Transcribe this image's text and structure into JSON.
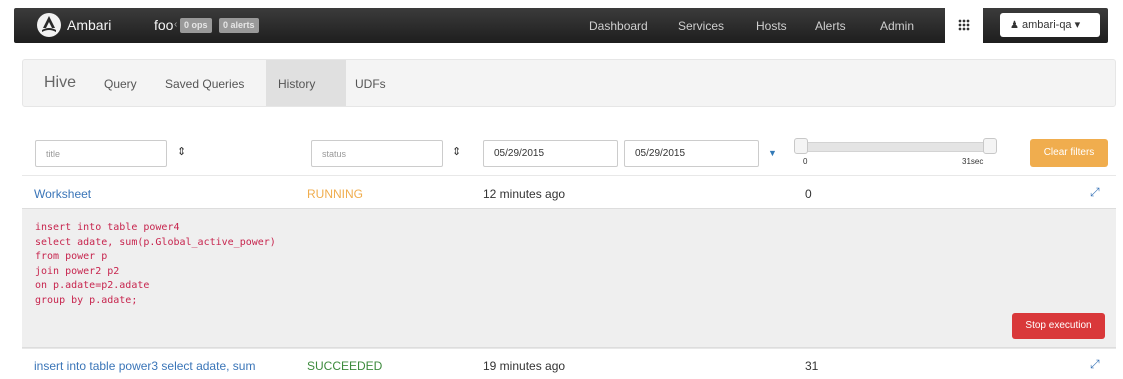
{
  "navbar": {
    "brand": "Ambari",
    "cluster_name": "foo",
    "ops_badge": "0 ops",
    "alerts_badge": "0 alerts",
    "links": [
      "Dashboard",
      "Services",
      "Hosts",
      "Alerts",
      "Admin"
    ],
    "user_label": "ambari-qa",
    "user_caret": "▾"
  },
  "hive_nav": {
    "title": "Hive",
    "tabs": [
      "Query",
      "Saved Queries",
      "History",
      "UDFs"
    ],
    "active_tab": "History"
  },
  "filters": {
    "title_placeholder": "title",
    "status_placeholder": "status",
    "date_from": "05/29/2015",
    "date_to": "05/29/2015",
    "duration_min_label": "0",
    "duration_max_label": "31sec",
    "clear_label": "Clear filters"
  },
  "rows": [
    {
      "title": "Worksheet",
      "status": "RUNNING",
      "time": "12 minutes ago",
      "duration": "0",
      "query": "insert into table power4\nselect adate, sum(p.Global_active_power)\nfrom power p\njoin power2 p2\non p.adate=p2.adate\ngroup by p.adate;",
      "stop_label": "Stop execution"
    },
    {
      "title": "insert into table power3 select adate, sum",
      "status": "SUCCEEDED",
      "time": "19 minutes ago",
      "duration": "31"
    }
  ],
  "icons": {
    "sort": "sort-icon",
    "expand": "expand-icon",
    "user": "user-icon",
    "grid": "grid-icon"
  },
  "colors": {
    "running": "#f0ad4e",
    "succeeded": "#3c8a3c",
    "link": "#3a75b8",
    "clear_filters": "#f0ad4e",
    "stop_execution": "#d9383a"
  }
}
